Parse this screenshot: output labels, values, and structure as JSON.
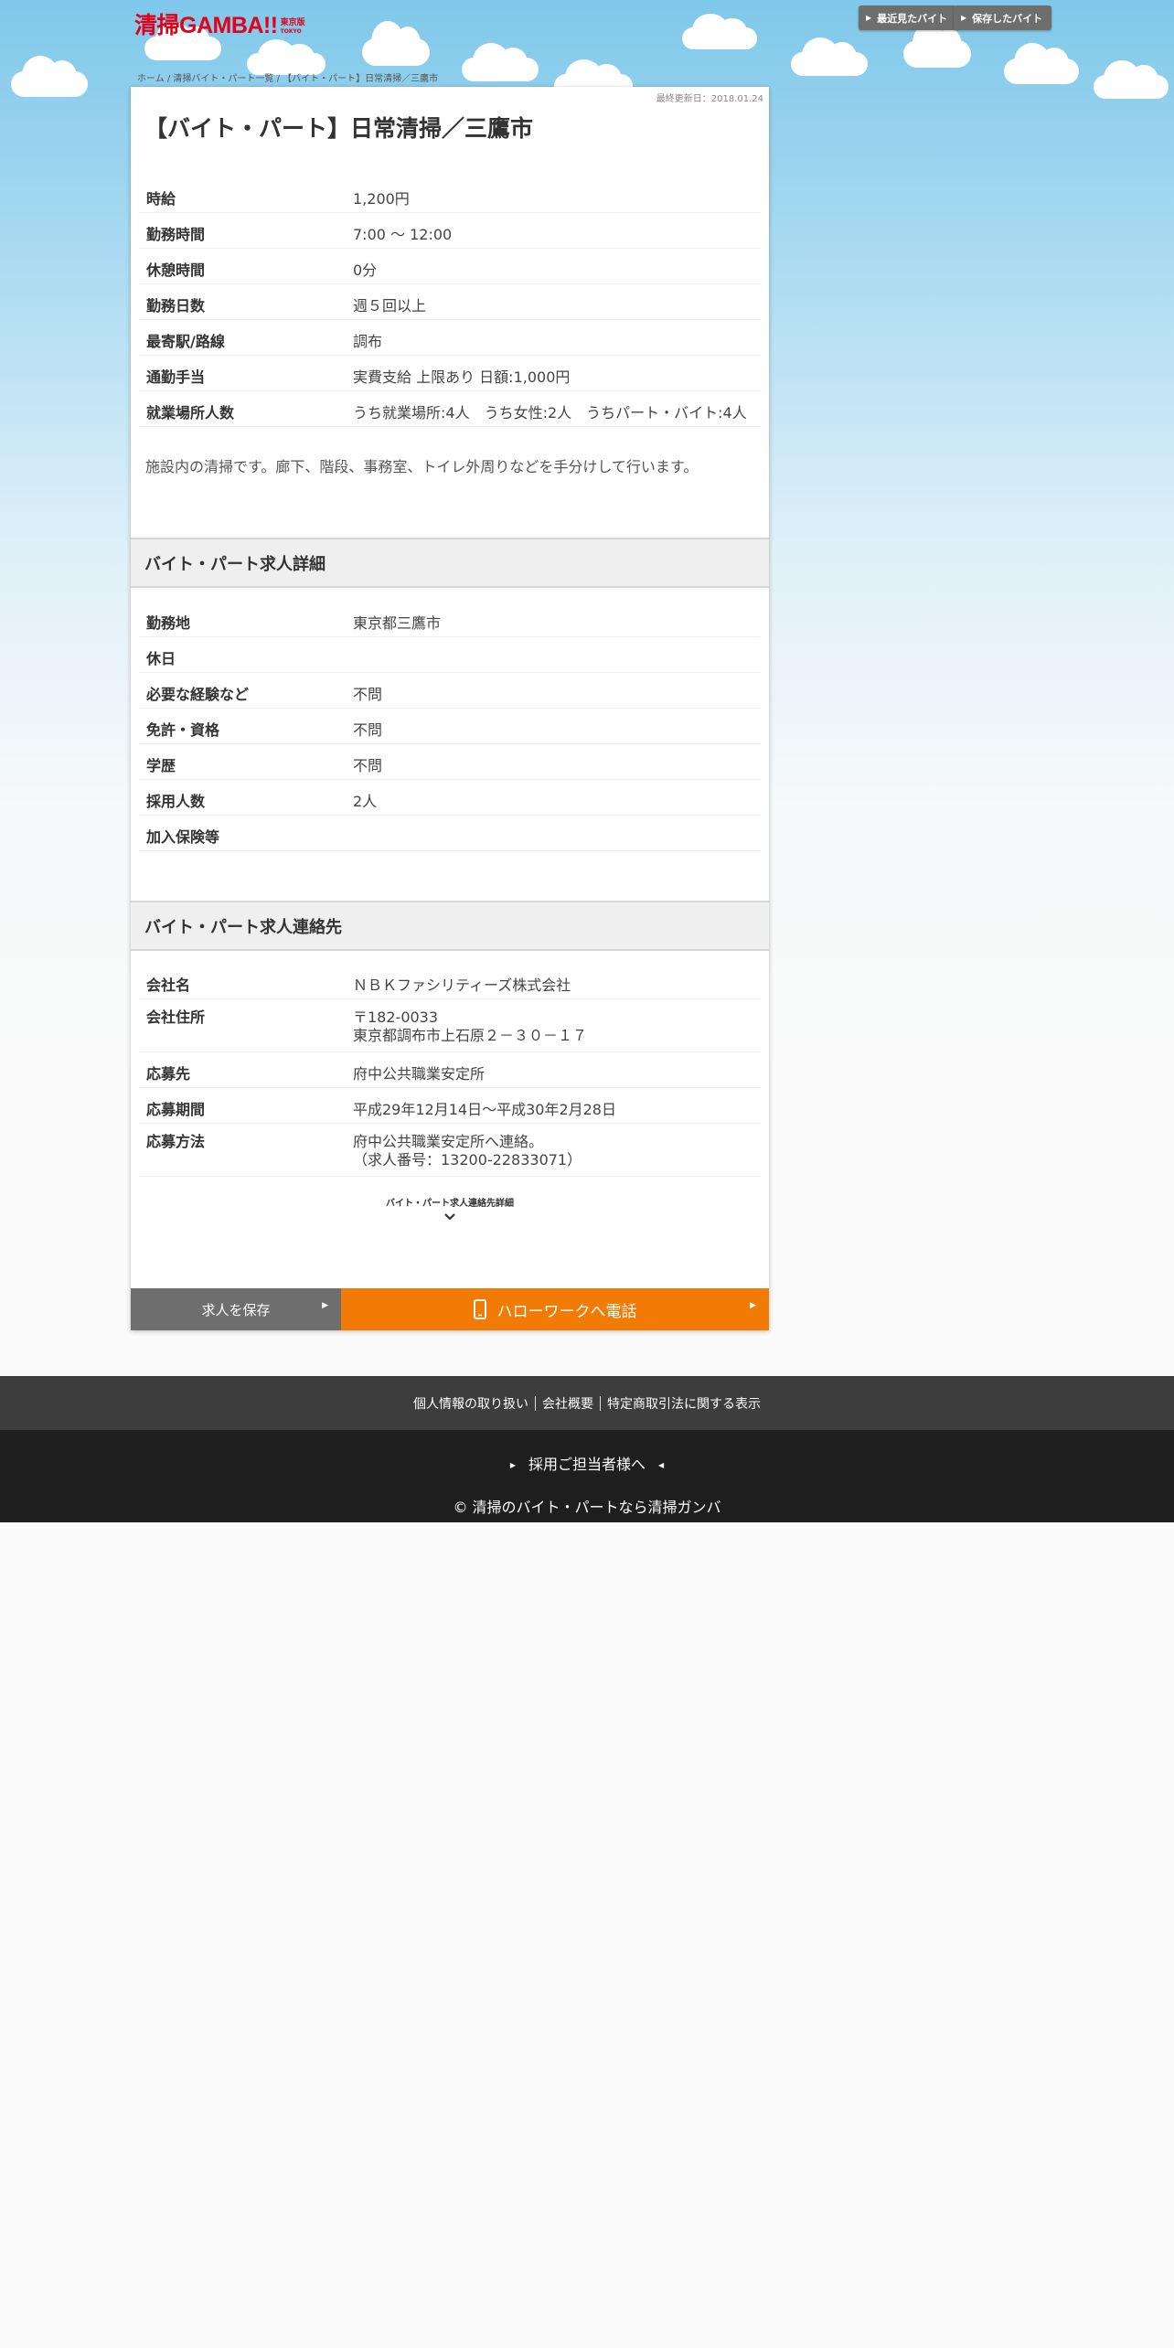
{
  "header": {
    "logo_text": "清掃GAMBA!!",
    "logo_sub_line1": "東京版",
    "logo_sub_line2": "TOKYO",
    "recent_button": "最近見たバイト",
    "saved_button": "保存したバイト"
  },
  "breadcrumb": "ホーム / 清掃バイト・パート一覧 / 【バイト・パート】日常清掃／三鷹市",
  "job": {
    "updated": "最終更新日：2018.01.24",
    "title": "【バイト・パート】日常清掃／三鷹市",
    "summary": [
      {
        "label": "時給",
        "value": "1,200円"
      },
      {
        "label": "勤務時間",
        "value": "7:00 ～ 12:00"
      },
      {
        "label": "休憩時間",
        "value": "0分"
      },
      {
        "label": "勤務日数",
        "value": "週５回以上"
      },
      {
        "label": "最寄駅/路線",
        "value": "調布"
      },
      {
        "label": "通勤手当",
        "value": "実費支給 上限あり 日額:1,000円"
      },
      {
        "label": "就業場所人数",
        "value": "うち就業場所:4人　うち女性:2人　うちパート・バイト:4人"
      }
    ],
    "description": "施設内の清掃です。廊下、階段、事務室、トイレ外周りなどを手分けして行います。"
  },
  "details": {
    "heading": "バイト・パート求人詳細",
    "rows": [
      {
        "label": "勤務地",
        "value": "東京都三鷹市"
      },
      {
        "label": "休日",
        "value": ""
      },
      {
        "label": "必要な経験など",
        "value": "不問"
      },
      {
        "label": "免許・資格",
        "value": "不問"
      },
      {
        "label": "学歴",
        "value": "不問"
      },
      {
        "label": "採用人数",
        "value": "2人"
      },
      {
        "label": "加入保険等",
        "value": ""
      }
    ]
  },
  "contact": {
    "heading": "バイト・パート求人連絡先",
    "rows": [
      {
        "label": "会社名",
        "value": "ＮＢＫファシリティーズ株式会社",
        "value2": ""
      },
      {
        "label": "会社住所",
        "value": "〒182-0033",
        "value2": "東京都調布市上石原２－３０－１７"
      },
      {
        "label": "応募先",
        "value": "府中公共職業安定所",
        "value2": ""
      },
      {
        "label": "応募期間",
        "value": "平成29年12月14日〜平成30年2月28日",
        "value2": ""
      },
      {
        "label": "応募方法",
        "value": "府中公共職業安定所へ連絡。",
        "value2": "（求人番号：13200-22833071）"
      }
    ],
    "more_label": "バイト・パート求人連絡先詳細"
  },
  "actions": {
    "save": "求人を保存",
    "call": "ハローワークへ電話"
  },
  "footer": {
    "links": [
      "個人情報の取り扱い",
      "会社概要",
      "特定商取引法に関する表示"
    ],
    "recruit": "採用ご担当者様へ",
    "copyright": "© 清掃のバイト・パートなら清掃ガンバ"
  },
  "colors": {
    "brand_red": "#e2001a",
    "call_orange": "#f27b06",
    "button_gray": "#6e6e6e",
    "sky_blue": "#7fc8ea"
  },
  "icons": [
    "play-icon",
    "chevron-down-icon",
    "smartphone-icon"
  ]
}
